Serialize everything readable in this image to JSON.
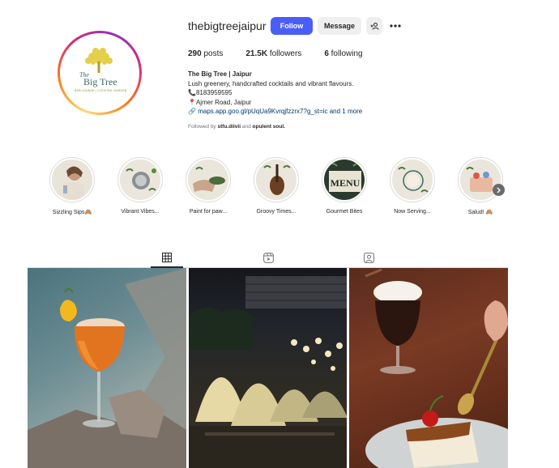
{
  "profile": {
    "username": "thebigtreejaipur",
    "follow_label": "Follow",
    "message_label": "Message",
    "add_user_icon": "add-person-icon",
    "more_icon": "more-dots-icon",
    "avatar": {
      "logo_the": "The",
      "logo_name": "Big Tree",
      "logo_sub": "BAR LOUNGE | COCKTAIL GARDEN"
    },
    "stats": {
      "posts_count": "290",
      "posts_label": "posts",
      "followers_count": "21.5K",
      "followers_label": "followers",
      "following_count": "6",
      "following_label": "following"
    },
    "bio": {
      "name": "The Big Tree | Jaipur",
      "line1": "Lush greenery, handcrafted cocktails and vibrant flavours.",
      "phone": "📞8183959595",
      "address": "📍Ajmer Road, Jaipur",
      "link_icon": "🔗",
      "link": "maps.app.goo.gl/pUqUa9Kvrqjfzzrx7?g_st=ic and 1 more"
    },
    "followed_by": {
      "prefix": "Followed by",
      "user1": "stfu.diivii",
      "conj": "and",
      "user2": "opulent soul."
    }
  },
  "highlights": [
    {
      "label": "Sizzling Sips🙈"
    },
    {
      "label": "Vibrant Vibes..."
    },
    {
      "label": "Paint for paw..."
    },
    {
      "label": "Groovy Times..."
    },
    {
      "label": "Gourmet Bites"
    },
    {
      "label": "Now Serving..."
    },
    {
      "label": "Salud! 🙈"
    }
  ],
  "highlight_next_icon": "chevron-right-icon",
  "tabs": [
    {
      "name": "posts",
      "icon": "grid-icon",
      "active": true
    },
    {
      "name": "reels",
      "icon": "reels-icon",
      "active": false
    },
    {
      "name": "tagged",
      "icon": "tagged-person-icon",
      "active": false
    }
  ],
  "menu_board_text": "MENU",
  "colors": {
    "follow_button": "#4a5df9",
    "link": "#00376b",
    "secondary_button": "#efefef"
  }
}
